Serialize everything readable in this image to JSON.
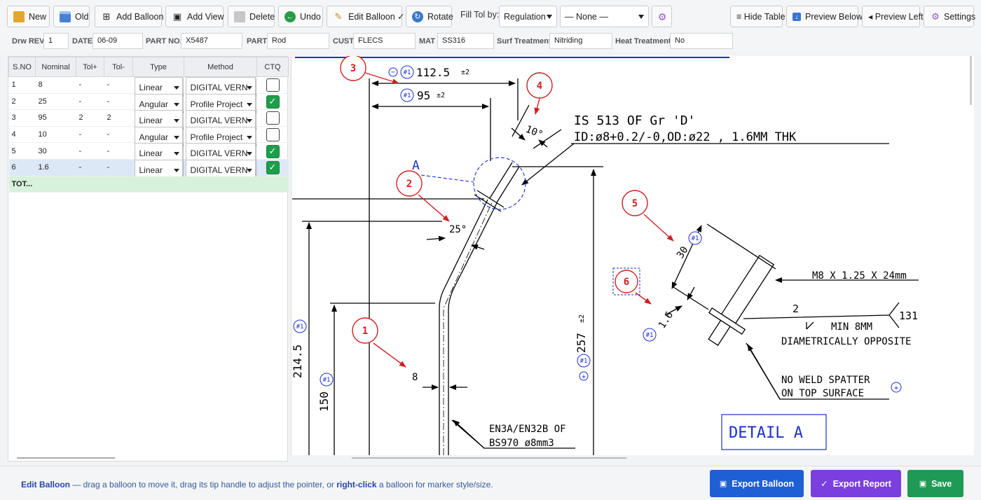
{
  "toolbar": {
    "new": "New",
    "old": "Old",
    "add_balloon": "Add Balloon",
    "add_view": "Add View",
    "delete": "Delete",
    "undo": "Undo",
    "edit_balloon": "Edit Balloon ✓",
    "rotate": "Rotate",
    "fill_tol_label": "Fill Tol by:",
    "fill_tol_value": "Regulation",
    "preset_value": "— None —",
    "hide_table": "≡ Hide Table",
    "preview_below": "Preview Below",
    "preview_left": "◂ Preview Left",
    "settings": "Settings"
  },
  "meta": {
    "drw_rev_label": "Drw REV",
    "drw_rev": "1",
    "date_label": "DATE",
    "date": "06-09",
    "part_no_label": "PART NO.",
    "part_no": "X5487",
    "part_label": "PART",
    "part": "Rod",
    "cust_label": "CUST",
    "cust": "FLECS",
    "mat_label": "MAT",
    "mat": "SS316",
    "surf_label": "Surf Treatment",
    "surf": "Nitriding",
    "heat_label": "Heat Treatment",
    "heat": "No"
  },
  "table": {
    "headers": [
      "S.NO",
      "Nominal",
      "Tol+",
      "Tol-",
      "Type",
      "Method",
      "CTQ"
    ],
    "rows": [
      {
        "sno": "1",
        "nominal": "8",
        "tolp": "-",
        "tolm": "-",
        "type": "Linear",
        "method": "DIGITAL VERN",
        "ctq": false
      },
      {
        "sno": "2",
        "nominal": "25",
        "tolp": "-",
        "tolm": "-",
        "type": "Angular",
        "method": "Profile Project",
        "ctq": true
      },
      {
        "sno": "3",
        "nominal": "95",
        "tolp": "2",
        "tolm": "2",
        "type": "Linear",
        "method": "DIGITAL VERN",
        "ctq": false
      },
      {
        "sno": "4",
        "nominal": "10",
        "tolp": "-",
        "tolm": "-",
        "type": "Angular",
        "method": "Profile Project",
        "ctq": false
      },
      {
        "sno": "5",
        "nominal": "30",
        "tolp": "-",
        "tolm": "-",
        "type": "Linear",
        "method": "DIGITAL VERN",
        "ctq": true
      },
      {
        "sno": "6",
        "nominal": "1.6",
        "tolp": "-",
        "tolm": "-",
        "type": "Linear",
        "method": "DIGITAL VERN",
        "ctq": true
      }
    ],
    "total_label": "TOT..."
  },
  "drawing": {
    "balloons": [
      "1",
      "2",
      "3",
      "4",
      "5",
      "6"
    ],
    "dims": {
      "d112": "112.5",
      "d95": "95",
      "tol2": "±2",
      "d10": "10°",
      "d25": "25°",
      "d8": "8",
      "d2145": "214.5",
      "d150": "150",
      "d257": "257",
      "d30": "30",
      "d16": "1.6",
      "d2": "2",
      "d131": "131"
    },
    "tag": "#1",
    "notes": {
      "is513": "IS 513 OF Gr 'D'",
      "id": "ID:ø8+0.2/-0,OD:ø22 , 1.6MM THK",
      "m8": "M8 X 1.25 X 24mm",
      "min8": "MIN 8MM",
      "diam": "DIAMETRICALLY OPPOSITE",
      "nws1": "NO WELD SPATTER",
      "nws2": "ON TOP SURFACE",
      "en3a": "EN3A/EN32B OF",
      "bs970": "BS970 ø8mm3",
      "detail": "DETAIL A",
      "a": "A"
    }
  },
  "footer": {
    "hint_bold1": "Edit Balloon",
    "hint_text1": " — drag a balloon to move it, drag its tip handle to adjust the pointer, or ",
    "hint_bold2": "right-click",
    "hint_text2": " a balloon for marker style/size.",
    "export_balloon": "Export Balloon",
    "export_report": "Export Report",
    "save": "Save"
  },
  "colors": {
    "balloon_red": "#d02020",
    "tag_blue": "#1a2fd0",
    "export_blue": "#1f5fd6",
    "export_purple": "#7b3fe0",
    "save_green": "#1e9a55"
  }
}
